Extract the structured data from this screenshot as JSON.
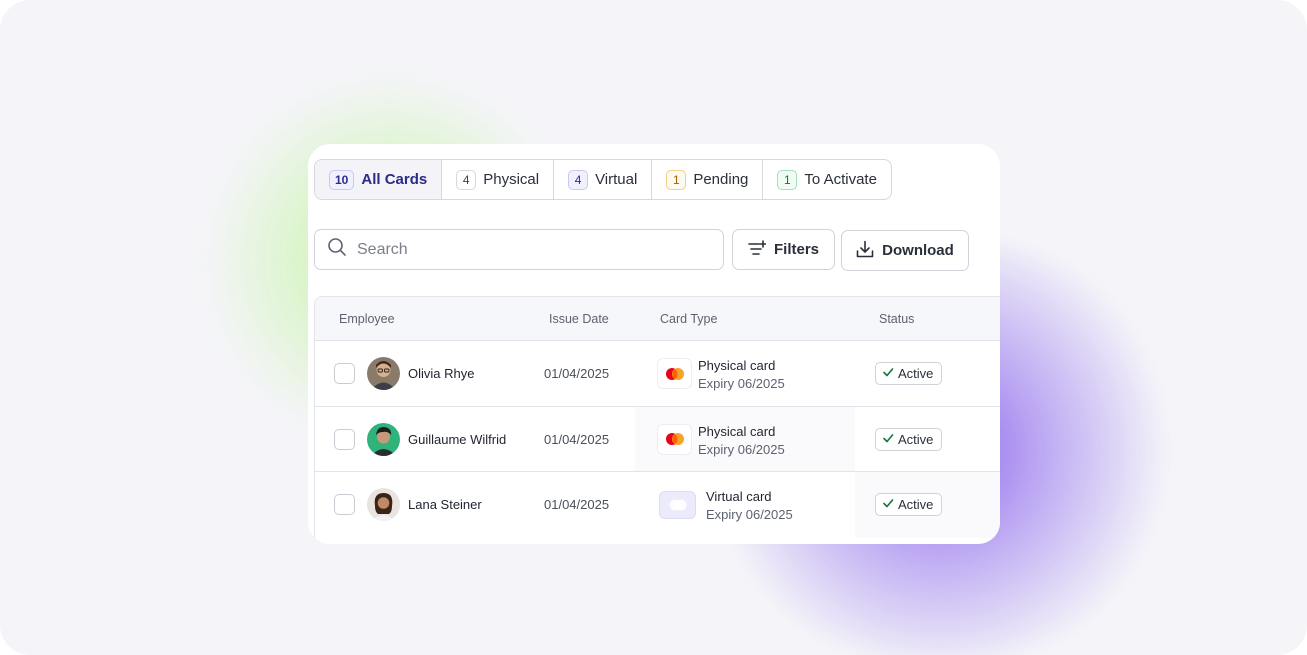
{
  "tabs": [
    {
      "count": "10",
      "label": "All Cards",
      "active": true
    },
    {
      "count": "4",
      "label": "Physical"
    },
    {
      "count": "4",
      "label": "Virtual"
    },
    {
      "count": "1",
      "label": "Pending"
    },
    {
      "count": "1",
      "label": "To Activate"
    }
  ],
  "toolbar": {
    "search_placeholder": "Search",
    "filters_label": "Filters",
    "download_label": "Download"
  },
  "table": {
    "columns": [
      "Employee",
      "Issue Date",
      "Card Type",
      "Status"
    ],
    "rows": [
      {
        "name": "Olivia Rhye",
        "issue_date": "01/04/2025",
        "card_type": "Physical card",
        "expiry": "Expiry 06/2025",
        "status": "Active",
        "card_icon": "mastercard-icon"
      },
      {
        "name": "Guillaume Wilfrid",
        "issue_date": "01/04/2025",
        "card_type": "Physical card",
        "expiry": "Expiry 06/2025",
        "status": "Active",
        "card_icon": "mastercard-icon"
      },
      {
        "name": "Lana Steiner",
        "issue_date": "01/04/2025",
        "card_type": "Virtual card",
        "expiry": "Expiry 06/2025",
        "status": "Active",
        "card_icon": "virtual-card-icon"
      }
    ]
  },
  "colors": {
    "active_tab_text": "#2a2b8a",
    "status_check": "#17743f",
    "mastercard_red": "#eb001b",
    "mastercard_orange": "#f79e1b"
  }
}
